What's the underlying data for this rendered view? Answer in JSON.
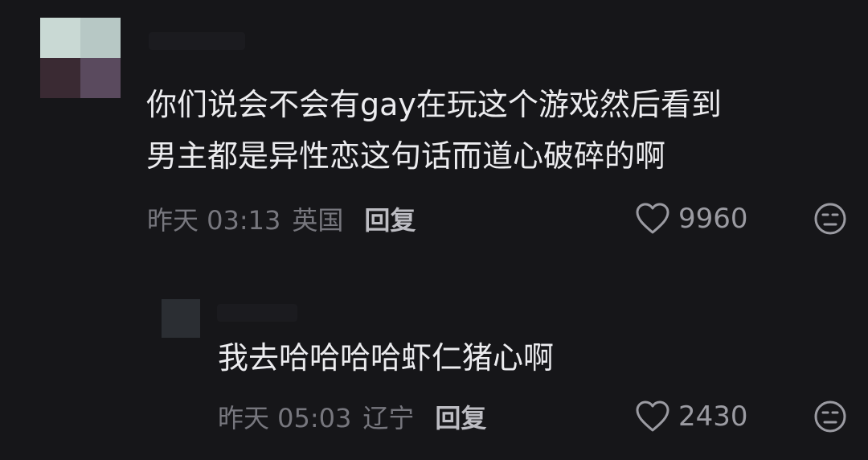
{
  "comments": [
    {
      "text": "你们说会不会有gay在玩这个游戏然后看到\n男主都是异性恋这句话而道心破碎的啊",
      "time": "昨天 03:13",
      "location": "英国",
      "reply_label": "回复",
      "like_count": "9960"
    },
    {
      "text": "我去哈哈哈哈虾仁猪心啊",
      "time": "昨天 05:03",
      "location": "辽宁",
      "reply_label": "回复",
      "like_count": "2430"
    }
  ],
  "icons": {
    "like": "heart-outline-icon",
    "dislike": "unhappy-face-icon"
  },
  "colors": {
    "background": "#161619",
    "text": "#ececef",
    "meta": "#77777e",
    "reply": "#bdbdc3"
  }
}
